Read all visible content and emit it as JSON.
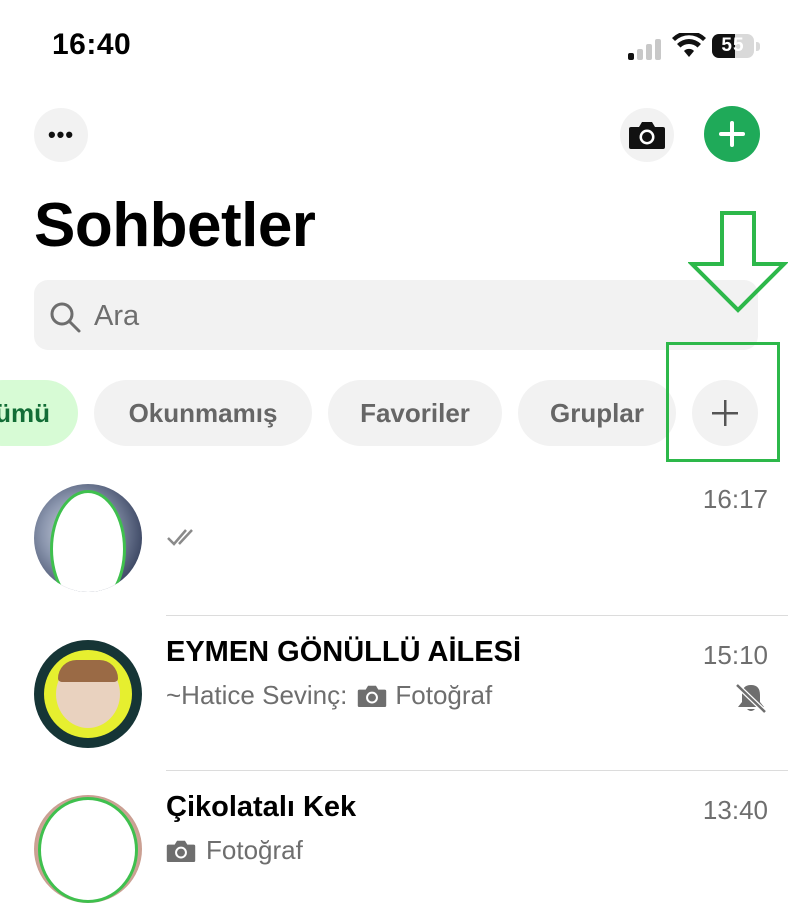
{
  "status_bar": {
    "time": "16:40",
    "battery": "55",
    "battery_level": 0.55
  },
  "header": {
    "title": "Sohbetler"
  },
  "search": {
    "placeholder": "Ara"
  },
  "filters": [
    {
      "label": "ümü",
      "selected": true
    },
    {
      "label": "Okunmamış"
    },
    {
      "label": "Favoriler"
    },
    {
      "label": "Gruplar"
    },
    {
      "label": "+"
    }
  ],
  "chats": [
    {
      "name": "",
      "preview": "",
      "time": "16:17",
      "icons": [
        "double-check-icon"
      ]
    },
    {
      "name": "EYMEN GÖNÜLLÜ AİLESİ",
      "sender": "~Hatice Sevinç:",
      "preview": "Fotoğraf",
      "time": "15:10",
      "icons": [
        "camera-icon",
        "muted-bell-icon"
      ]
    },
    {
      "name": "Çikolatalı Kek",
      "preview": "Fotoğraf",
      "time": "13:40",
      "icons": [
        "camera-icon"
      ]
    }
  ],
  "colors": {
    "accent": "#1faa59",
    "annotation": "#2db84a",
    "chip_selected_bg": "#d7fbd5",
    "chip_selected_text": "#126d36"
  }
}
